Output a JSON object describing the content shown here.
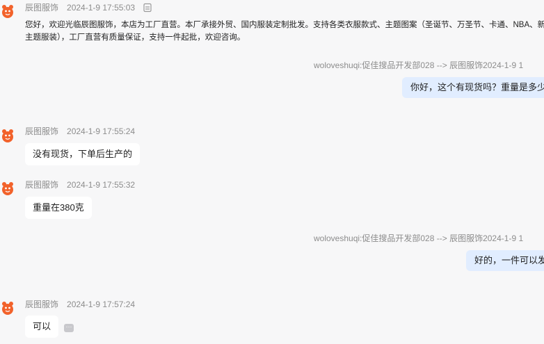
{
  "messages": [
    {
      "sender": "辰图服饰",
      "time": "2024-1-9 17:55:03",
      "text": "您好，欢迎光临辰图服饰，本店为工厂直营。本厂承接外贸、国内服装定制批发。支持各类衣服款式、主题图案（圣诞节、万圣节、卡通、NBA、新年主题服装），工厂直营有质量保证，支持一件起批，欢迎咨询。"
    },
    {
      "sender": "woloveshuqi:促佳搜品开发部028 --> 辰图服饰",
      "time": "2024-1-9 1",
      "text": "你好，这个有现货吗？重量是多少"
    },
    {
      "sender": "辰图服饰",
      "time": "2024-1-9 17:55:24",
      "text": "没有现货，下单后生产的"
    },
    {
      "sender": "辰图服饰",
      "time": "2024-1-9 17:55:32",
      "text": "重量在380克"
    },
    {
      "sender": "woloveshuqi:促佳搜品开发部028 --> 辰图服饰",
      "time": "2024-1-9 1",
      "text": "好的，一件可以发"
    },
    {
      "sender": "辰图服饰",
      "time": "2024-1-9 17:57:24",
      "text": "可以"
    }
  ],
  "icons": {
    "avatar": "orange-mascot-avatar-icon",
    "copy": "copy-icon",
    "more": "more-options-icon"
  },
  "colors": {
    "background": "#f7f7f8",
    "right_bubble": "#e1edff",
    "meta_text": "#8c8c8c",
    "avatar": "#f2622b"
  }
}
